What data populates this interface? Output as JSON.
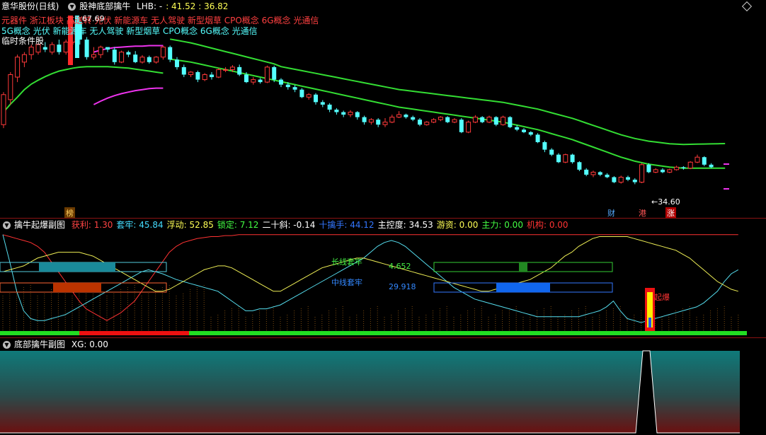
{
  "main": {
    "stock": "意华股份(日线)",
    "indicator": "股神底部擒牛",
    "lhb_label": "LHB: -",
    "lhb_values": ": 41.52 : 36.82",
    "concepts_red": "元器件 浙江板块 高送转 光伏 新能源车 无人驾驶 新型烟草 CPO概念 6G概念 光通信",
    "concepts_cyan": "5G概念 光伏 新能源车 无人驾驶 新型烟草 CPO概念 6G概念 光通信",
    "temp_condition": "临时条件股",
    "high_label": "67.69",
    "low_label": "←34.60",
    "tags": {
      "bang": "榜",
      "cai": "财",
      "gang": "港",
      "zhang": "涨"
    },
    "colors": {
      "up": "#ff3a3a",
      "down": "#54ffff",
      "ma_green": "#33dd33",
      "band_magenta": "#ee33ee"
    },
    "candles": [
      [
        46.5,
        52.5,
        45.8,
        53.0
      ],
      [
        51.5,
        56.5,
        50.5,
        57.0
      ],
      [
        56.0,
        60.0,
        55.0,
        60.5
      ],
      [
        59.0,
        60.5,
        58.0,
        61.0
      ],
      [
        60.5,
        62.0,
        59.5,
        62.5
      ],
      [
        61.0,
        62.5,
        60.5,
        63.0
      ],
      [
        62.0,
        61.5,
        61.0,
        63.0
      ],
      [
        61.0,
        62.5,
        60.5,
        63.0
      ],
      [
        62.5,
        61.0,
        60.5,
        63.5
      ],
      [
        61.0,
        63.0,
        60.5,
        63.5
      ],
      [
        63.0,
        67.0,
        62.5,
        67.5
      ],
      [
        67.0,
        63.5,
        62.5,
        68.0
      ],
      [
        63.5,
        60.0,
        59.5,
        64.0
      ],
      [
        60.0,
        60.5,
        59.5,
        62.0
      ],
      [
        60.5,
        62.0,
        59.8,
        62.3
      ],
      [
        62.0,
        61.5,
        61.0,
        62.0
      ],
      [
        61.5,
        59.0,
        58.5,
        62.0
      ],
      [
        59.0,
        61.0,
        58.8,
        61.3
      ],
      [
        61.0,
        60.5,
        60.0,
        61.3
      ],
      [
        60.5,
        59.0,
        58.8,
        61.2
      ],
      [
        59.0,
        60.0,
        58.7,
        60.4
      ],
      [
        60.0,
        59.0,
        58.7,
        60.3
      ],
      [
        59.0,
        60.0,
        58.7,
        60.2
      ],
      [
        60.0,
        62.0,
        59.5,
        62.3
      ],
      [
        62.0,
        59.5,
        59.0,
        62.3
      ],
      [
        59.5,
        58.0,
        57.5,
        60.0
      ],
      [
        58.0,
        56.5,
        56.0,
        58.5
      ],
      [
        56.5,
        57.0,
        56.0,
        57.2
      ],
      [
        57.0,
        55.5,
        55.0,
        57.3
      ],
      [
        55.5,
        56.5,
        55.2,
        56.8
      ],
      [
        56.5,
        56.0,
        55.5,
        57.0
      ],
      [
        56.0,
        57.5,
        55.8,
        57.8
      ],
      [
        57.5,
        57.5,
        57.0,
        58.0
      ],
      [
        57.5,
        58.0,
        57.0,
        58.4
      ],
      [
        58.0,
        56.5,
        56.2,
        58.5
      ],
      [
        56.5,
        55.0,
        54.8,
        57.0
      ],
      [
        55.0,
        55.5,
        54.5,
        56.0
      ],
      [
        55.5,
        55.0,
        54.7,
        55.8
      ],
      [
        55.0,
        58.0,
        54.8,
        58.3
      ],
      [
        58.0,
        55.5,
        55.0,
        58.3
      ],
      [
        55.5,
        54.5,
        54.0,
        55.8
      ],
      [
        54.5,
        54.0,
        53.5,
        55.0
      ],
      [
        54.0,
        53.5,
        53.0,
        54.4
      ],
      [
        53.5,
        52.0,
        51.8,
        53.8
      ],
      [
        52.0,
        52.5,
        51.5,
        52.8
      ],
      [
        52.5,
        51.0,
        50.5,
        52.8
      ],
      [
        51.0,
        50.5,
        50.0,
        51.4
      ],
      [
        50.5,
        49.5,
        49.0,
        50.8
      ],
      [
        49.5,
        49.0,
        48.5,
        49.8
      ],
      [
        49.0,
        48.5,
        48.0,
        49.3
      ],
      [
        48.5,
        49.0,
        48.0,
        49.4
      ],
      [
        49.0,
        48.0,
        47.5,
        49.2
      ],
      [
        48.0,
        47.0,
        46.5,
        48.3
      ],
      [
        47.0,
        47.5,
        46.5,
        47.8
      ],
      [
        47.5,
        46.5,
        46.0,
        47.8
      ],
      [
        46.5,
        47.0,
        46.0,
        47.8
      ],
      [
        47.0,
        48.0,
        46.8,
        48.5
      ],
      [
        48.0,
        48.5,
        47.8,
        49.2
      ],
      [
        48.5,
        48.0,
        47.7,
        48.7
      ],
      [
        48.0,
        47.5,
        47.2,
        48.3
      ],
      [
        47.5,
        46.5,
        46.2,
        47.8
      ],
      [
        46.5,
        47.0,
        46.3,
        47.2
      ],
      [
        47.0,
        47.5,
        46.8,
        47.8
      ],
      [
        47.5,
        48.0,
        47.2,
        48.2
      ],
      [
        48.0,
        47.0,
        46.8,
        48.2
      ],
      [
        47.0,
        47.5,
        46.8,
        47.8
      ],
      [
        47.5,
        45.0,
        44.8,
        47.8
      ],
      [
        45.0,
        47.0,
        44.8,
        47.3
      ],
      [
        47.0,
        48.0,
        46.8,
        48.4
      ],
      [
        48.0,
        47.0,
        46.8,
        48.2
      ],
      [
        47.0,
        48.0,
        46.8,
        48.3
      ],
      [
        48.0,
        46.5,
        46.2,
        48.2
      ],
      [
        46.5,
        48.0,
        46.3,
        48.3
      ],
      [
        48.0,
        46.0,
        45.8,
        48.2
      ],
      [
        46.0,
        45.5,
        45.2,
        46.4
      ],
      [
        45.5,
        45.0,
        44.8,
        45.8
      ],
      [
        45.0,
        44.5,
        44.2,
        45.2
      ],
      [
        44.5,
        43.0,
        42.8,
        44.8
      ],
      [
        43.0,
        41.5,
        41.0,
        43.3
      ],
      [
        41.5,
        40.5,
        40.2,
        41.8
      ],
      [
        40.5,
        39.0,
        38.8,
        40.8
      ],
      [
        39.0,
        40.5,
        38.8,
        40.7
      ],
      [
        40.5,
        39.0,
        38.7,
        40.7
      ],
      [
        39.0,
        37.5,
        37.2,
        39.2
      ],
      [
        37.5,
        36.5,
        36.2,
        37.8
      ],
      [
        36.5,
        37.0,
        36.0,
        37.3
      ],
      [
        37.0,
        36.5,
        36.2,
        37.2
      ],
      [
        36.5,
        36.0,
        35.8,
        36.8
      ],
      [
        36.0,
        35.0,
        34.8,
        36.2
      ],
      [
        35.0,
        36.0,
        34.7,
        36.3
      ],
      [
        36.0,
        35.5,
        35.2,
        36.3
      ],
      [
        35.5,
        35.0,
        34.6,
        35.8
      ],
      [
        35.0,
        38.5,
        34.8,
        38.8
      ],
      [
        38.5,
        37.0,
        36.8,
        38.8
      ],
      [
        37.0,
        37.5,
        36.8,
        37.8
      ],
      [
        37.5,
        37.0,
        36.8,
        37.8
      ],
      [
        37.0,
        37.5,
        36.8,
        37.7
      ],
      [
        37.5,
        38.0,
        37.3,
        38.3
      ],
      [
        38.0,
        37.8,
        37.5,
        38.2
      ],
      [
        37.8,
        39.0,
        37.6,
        39.2
      ],
      [
        39.0,
        40.0,
        38.8,
        40.5
      ],
      [
        40.0,
        38.5,
        38.2,
        40.2
      ],
      [
        38.5,
        38.0,
        37.8,
        38.8
      ]
    ],
    "ma": [
      52,
      53.6,
      55,
      56.5,
      57.6,
      58.4,
      59.1,
      59.7,
      60.2,
      60.5,
      60.8,
      61.0,
      61.1,
      61.1,
      61.1,
      61.1,
      61.0,
      60.9,
      60.8,
      60.6,
      60.4,
      60.2,
      60.0,
      59.8,
      59.6,
      59.4,
      59.2,
      59.0,
      58.7,
      58.4,
      58.1,
      57.8,
      57.5,
      57.2,
      56.9,
      56.6,
      56.3,
      56.0,
      55.7,
      55.4,
      55.1,
      54.8,
      54.5,
      54.2,
      53.9,
      53.6,
      53.3,
      53.0,
      52.7,
      52.4,
      52.1,
      51.8,
      51.5,
      51.2,
      50.9,
      50.6,
      50.3,
      50.0,
      49.8,
      49.6,
      49.4,
      49.2,
      49.0,
      48.8,
      48.6,
      48.4,
      48.2,
      48.0,
      47.8,
      47.6,
      47.4,
      47.2,
      47.0,
      46.7,
      46.4,
      46.1,
      45.8,
      45.5,
      45.1,
      44.7,
      44.3,
      43.9,
      43.5,
      43.0,
      42.5,
      42.0,
      41.5,
      41.0,
      40.5,
      40.0,
      39.6,
      39.2,
      38.9,
      38.6,
      38.4,
      38.2,
      38.0,
      37.9,
      37.8,
      37.8,
      37.8,
      37.8,
      37.8,
      37.8,
      37.8
    ],
    "band_upper": [
      null,
      null,
      null,
      null,
      null,
      null,
      null,
      null,
      null,
      null,
      null,
      null,
      null,
      61.0,
      61.4,
      61.7,
      61.9,
      62.0,
      62.1,
      62.2,
      62.2,
      62.3,
      62.3,
      62.3
    ],
    "band_lower": [
      null,
      null,
      null,
      null,
      null,
      null,
      null,
      null,
      null,
      null,
      null,
      null,
      null,
      50.5,
      51.2,
      51.8,
      52.3,
      52.7,
      53.0,
      53.3,
      53.5,
      53.7,
      53.8,
      53.8
    ]
  },
  "sub1": {
    "title": "擒牛起爆副图",
    "stats": [
      {
        "label": "获利: ",
        "value": "1.30",
        "color": "#ff4444"
      },
      {
        "label": "套牢: ",
        "value": "45.84",
        "color": "#44ddff"
      },
      {
        "label": "浮动: ",
        "value": "52.85",
        "color": "#ffff55"
      },
      {
        "label": "锁定: ",
        "value": "7.12",
        "color": "#44ff44"
      },
      {
        "label": "二十斜: ",
        "value": "-0.14",
        "color": "#ffffff"
      },
      {
        "label": "十擒手: ",
        "value": "44.12",
        "color": "#3377ff"
      },
      {
        "label": "主控度: ",
        "value": "34.53",
        "color": "#ffffff"
      },
      {
        "label": "游资: ",
        "value": "0.00",
        "color": "#ffff55"
      },
      {
        "label": "主力: ",
        "value": "0.00",
        "color": "#44ff44"
      },
      {
        "label": "机构: ",
        "value": "0.00",
        "color": "#ff3333"
      }
    ],
    "long_label": "长线套牢",
    "long_value": "4.652",
    "mid_label": "中线套牢",
    "mid_value": "29.918",
    "burst_label": "起爆",
    "cyan_line": [
      98,
      70,
      40,
      20,
      12,
      10,
      10,
      12,
      14,
      16,
      20,
      24,
      28,
      32,
      36,
      40,
      44,
      48,
      52,
      56,
      60,
      62,
      60,
      58,
      55,
      52,
      50,
      48,
      46,
      44,
      42,
      40,
      35,
      30,
      25,
      20,
      20,
      22,
      22,
      24,
      26,
      30,
      34,
      38,
      42,
      46,
      50,
      54,
      58,
      62,
      66,
      70,
      74,
      80,
      86,
      90,
      92,
      90,
      86,
      80,
      74,
      68,
      62,
      56,
      50,
      44,
      40,
      36,
      32,
      30,
      28,
      26,
      24,
      22,
      20,
      18,
      16,
      14,
      14,
      14,
      14,
      14,
      14,
      14,
      16,
      18,
      20,
      24,
      30,
      20,
      12,
      10,
      8,
      10,
      12,
      14,
      16,
      18,
      20,
      22,
      24,
      28,
      34,
      40,
      50,
      58,
      62
    ],
    "yellow_line": [
      60,
      62,
      64,
      66,
      70,
      74,
      76,
      78,
      80,
      80,
      80,
      80,
      78,
      76,
      72,
      68,
      64,
      60,
      56,
      52,
      48,
      44,
      40,
      40,
      42,
      46,
      50,
      54,
      58,
      62,
      64,
      66,
      66,
      64,
      60,
      56,
      52,
      48,
      44,
      40,
      40,
      44,
      48,
      52,
      56,
      60,
      64,
      66,
      68,
      70,
      72,
      74,
      74,
      72,
      70,
      68,
      66,
      64,
      62,
      60,
      58,
      56,
      54,
      52,
      50,
      48,
      46,
      44,
      42,
      40,
      40,
      42,
      44,
      46,
      48,
      50,
      52,
      56,
      60,
      64,
      70,
      76,
      80,
      86,
      90,
      94,
      96,
      96,
      96,
      96,
      96,
      94,
      92,
      90,
      88,
      86,
      84,
      82,
      78,
      74,
      68,
      62,
      56,
      50,
      46,
      42,
      40
    ],
    "red_line": [
      98,
      96,
      94,
      92,
      90,
      86,
      80,
      70,
      60,
      50,
      40,
      30,
      22,
      18,
      14,
      10,
      14,
      18,
      24,
      30,
      40,
      50,
      60,
      70,
      80,
      86,
      90,
      92,
      94,
      95,
      96,
      96,
      97,
      97,
      98,
      98,
      98,
      98,
      98,
      98,
      98,
      98,
      98,
      98,
      98,
      98,
      98,
      98,
      98,
      98,
      98,
      98,
      98,
      98,
      98,
      98,
      98,
      98,
      98,
      98,
      98,
      98,
      98,
      98,
      98,
      98,
      98,
      98,
      98,
      98,
      98,
      98,
      98,
      98,
      98,
      98,
      98,
      98,
      98,
      98,
      98,
      98,
      98,
      98,
      98,
      98,
      98,
      98,
      98,
      98,
      98,
      98,
      98,
      98,
      98,
      98,
      98,
      98,
      98,
      98,
      98,
      98,
      98,
      98,
      98,
      98,
      98
    ]
  },
  "sub2": {
    "title": "底部擒牛副图",
    "xg_label": "XG: 0.00"
  }
}
